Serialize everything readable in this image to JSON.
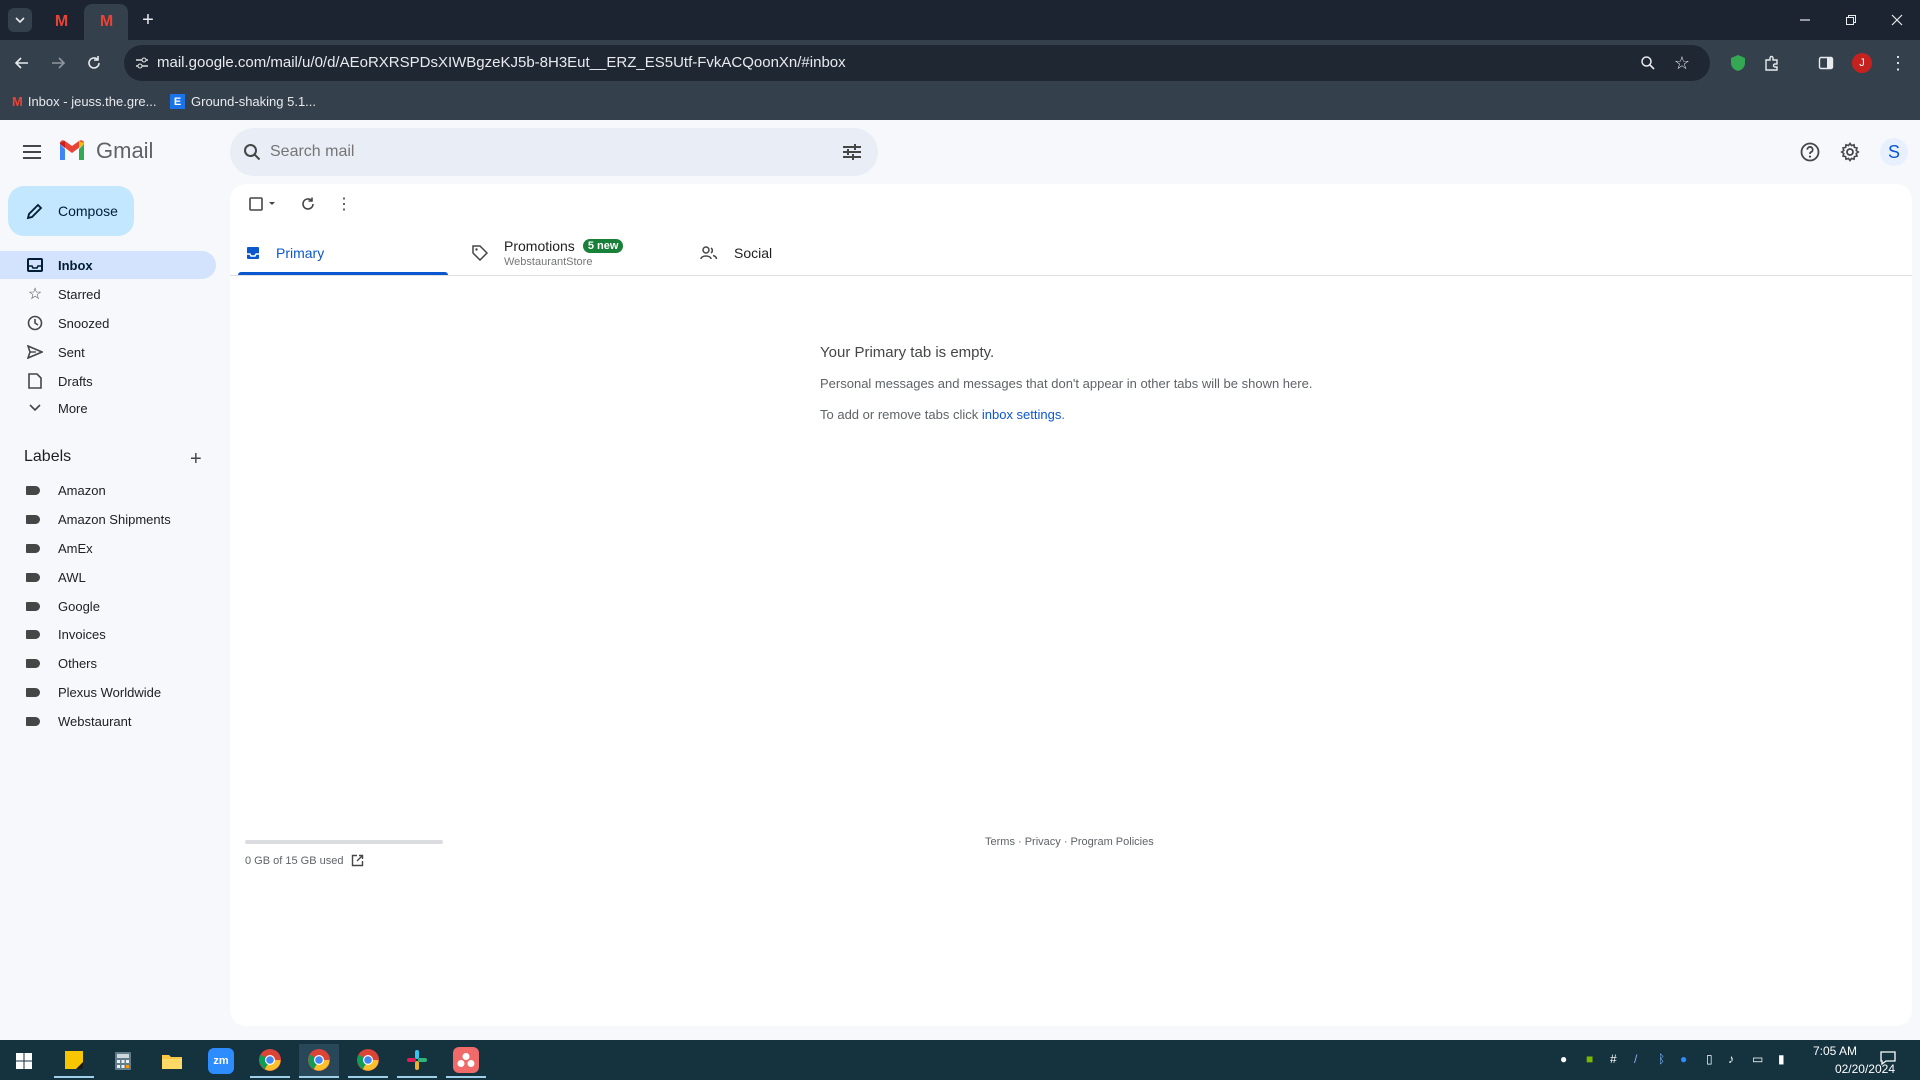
{
  "browser": {
    "url": "mail.google.com/mail/u/0/d/AEoRXRSPDsXIWBgzeKJ5b-8H3Eut__ERZ_ES5Utf-FvkACQoonXn/#inbox",
    "profile_initial": "J",
    "bookmarks": [
      {
        "label": "Inbox - jeuss.the.gre..."
      },
      {
        "label": "Ground-shaking 5.1..."
      }
    ]
  },
  "gmail": {
    "logo_text": "Gmail",
    "search_placeholder": "Search mail",
    "account_initial": "S",
    "compose_label": "Compose",
    "nav": [
      {
        "label": "Inbox",
        "icon": "inbox-icon"
      },
      {
        "label": "Starred",
        "icon": "star-icon"
      },
      {
        "label": "Snoozed",
        "icon": "clock-icon"
      },
      {
        "label": "Sent",
        "icon": "send-icon"
      },
      {
        "label": "Drafts",
        "icon": "draft-icon"
      },
      {
        "label": "More",
        "icon": "chevron-down-icon"
      }
    ],
    "labels_title": "Labels",
    "labels": [
      "Amazon",
      "Amazon Shipments",
      "AmEx",
      "AWL",
      "Google",
      "Invoices",
      "Others",
      "Plexus Worldwide",
      "Webstaurant"
    ],
    "tabs": {
      "primary": "Primary",
      "promotions": "Promotions",
      "promotions_badge": "5 new",
      "promotions_sub": "WebstaurantStore",
      "social": "Social"
    },
    "empty": {
      "title": "Your Primary tab is empty.",
      "line1": "Personal messages and messages that don't appear in other tabs will be shown here.",
      "line2_prefix": "To add or remove tabs click ",
      "line2_link": "inbox settings",
      "line2_suffix": "."
    },
    "storage": "0 GB of 15 GB used",
    "footer": "Terms · Privacy · Program Policies"
  },
  "taskbar": {
    "time": "7:05 AM",
    "date": "02/20/2024"
  },
  "colors": {
    "accent": "#0b57d0",
    "compose_bg": "#c2e7ff",
    "active_nav": "#d3e3fd",
    "taskbar": "#14333f"
  }
}
